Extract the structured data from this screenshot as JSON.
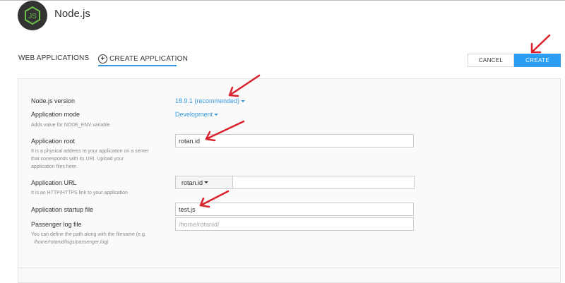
{
  "header": {
    "app_title": "Node.js",
    "logo_text": "JS"
  },
  "tabs": [
    {
      "label": "WEB APPLICATIONS",
      "active": false
    },
    {
      "label": "CREATE APPLICATION",
      "active": true
    }
  ],
  "actions": {
    "cancel_label": "CANCEL",
    "create_label": "CREATE"
  },
  "form": {
    "node_version": {
      "label": "Node.js version",
      "value": "18.9.1 (recommended)"
    },
    "app_mode": {
      "label": "Application mode",
      "value": "Development",
      "hint": "Adds value for NODE_ENV variable"
    },
    "app_root": {
      "label": "Application root",
      "value": "rotan.id",
      "hint1": "It is a physical address to your application on a server",
      "hint2": "that corresponds with its URI. Upload your",
      "hint3": "application files here."
    },
    "app_url": {
      "label": "Application URL",
      "domain": "rotan.id",
      "path": "",
      "hint": "It is an HTTP/HTTPS link to your application"
    },
    "startup_file": {
      "label": "Application startup file",
      "value": "test.js"
    },
    "passenger_log": {
      "label": "Passenger log file",
      "placeholder": "/home/rotanid/",
      "hint1": "You can define the path along with the filename (e.g.",
      "hint2": "/home/rotanid/logs/passenger.log)"
    }
  },
  "colors": {
    "accent": "#2a9df4",
    "link": "#3498db",
    "annotation_arrow": "#d9222e",
    "logo_green": "#6cc24a"
  }
}
